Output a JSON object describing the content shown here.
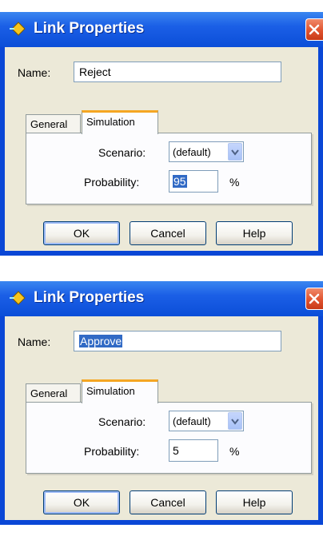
{
  "dialogs": [
    {
      "title": "Link Properties",
      "name_label": "Name:",
      "name_value": "Reject",
      "tabs": [
        "General",
        "Simulation"
      ],
      "scenario_label": "Scenario:",
      "scenario_value": "(default)",
      "probability_label": "Probability:",
      "probability_value": "95",
      "percent": "%",
      "buttons": {
        "ok": "OK",
        "cancel": "Cancel",
        "help": "Help"
      }
    },
    {
      "title": "Link Properties",
      "name_label": "Name:",
      "name_value": "Approve",
      "tabs": [
        "General",
        "Simulation"
      ],
      "scenario_label": "Scenario:",
      "scenario_value": "(default)",
      "probability_label": "Probability:",
      "probability_value": "5",
      "percent": "%",
      "buttons": {
        "ok": "OK",
        "cancel": "Cancel",
        "help": "Help"
      }
    }
  ],
  "colors": {
    "titlebar": "#1b5fe6",
    "frame": "#0a47d6",
    "panel": "#ece9d8",
    "close": "#e0532f",
    "tab_accent": "#f5a623",
    "selection": "#316ac5"
  },
  "icons": {
    "title": "diamond-link-icon",
    "close": "close-icon",
    "dropdown": "chevron-down-icon"
  }
}
